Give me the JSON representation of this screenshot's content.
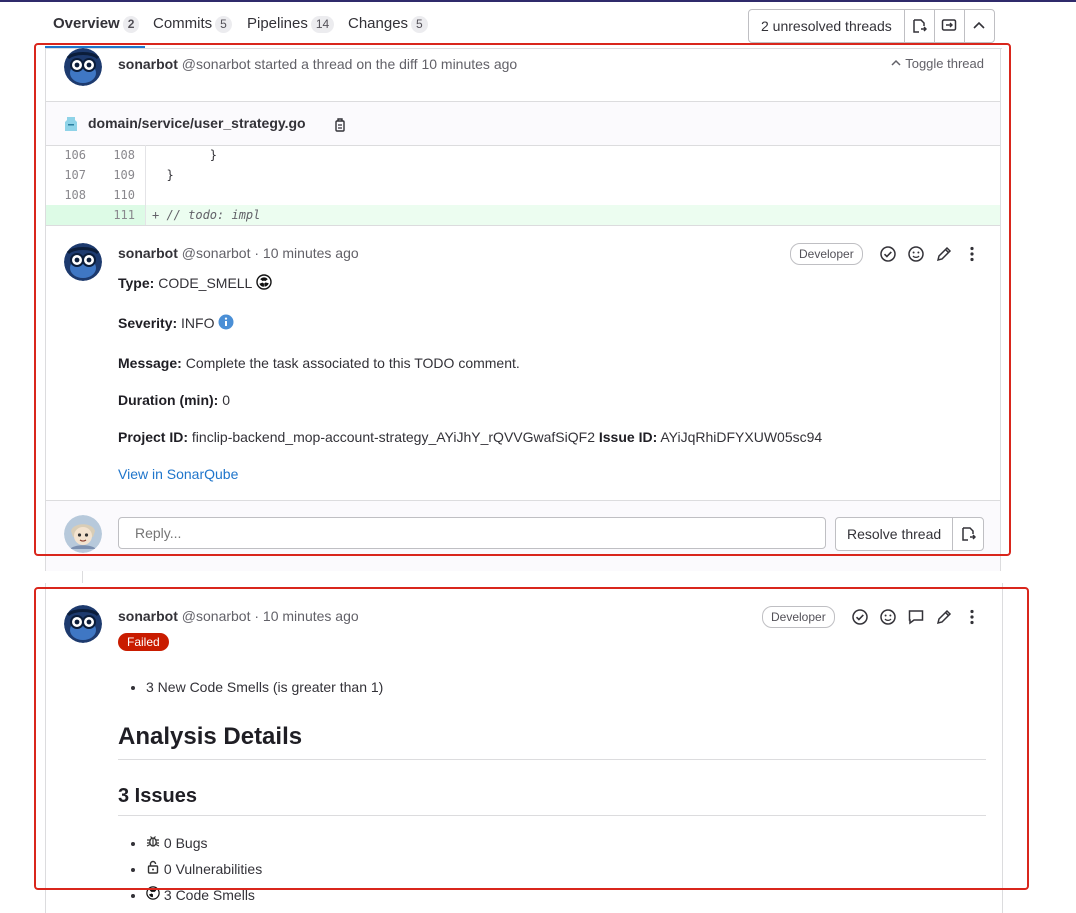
{
  "tabs": [
    {
      "label": "Overview",
      "count": "2"
    },
    {
      "label": "Commits",
      "count": "5"
    },
    {
      "label": "Pipelines",
      "count": "14"
    },
    {
      "label": "Changes",
      "count": "5"
    }
  ],
  "threads_button": {
    "label": "2 unresolved threads"
  },
  "thread1": {
    "author": "sonarbot",
    "handle": "@sonarbot",
    "action": "started a thread on the diff 10 minutes ago",
    "toggle": "Toggle thread",
    "file": "domain/service/user_strategy.go",
    "diff": [
      {
        "old": "106",
        "new": "108",
        "code": "        }",
        "type": "context"
      },
      {
        "old": "107",
        "new": "109",
        "code": "  }",
        "type": "context"
      },
      {
        "old": "108",
        "new": "110",
        "code": "",
        "type": "context"
      },
      {
        "old": "",
        "new": "111",
        "code": "+ // todo: impl",
        "type": "add"
      }
    ],
    "note": {
      "author": "sonarbot",
      "meta": "@sonarbot · 10 minutes ago",
      "role": "Developer",
      "type_label": "Type:",
      "type_value": "CODE_SMELL",
      "severity_label": "Severity:",
      "severity_value": "INFO",
      "message_label": "Message:",
      "message_value": "Complete the task associated to this TODO comment.",
      "duration_label": "Duration (min):",
      "duration_value": "0",
      "project_label": "Project ID:",
      "project_value": "finclip-backend_mop-account-strategy_AYiJhY_rQVVGwafSiQF2",
      "issue_label": "Issue ID:",
      "issue_value": "AYiJqRhiDFYXUW05sc94",
      "link": "View in SonarQube"
    },
    "reply_placeholder": "Reply...",
    "resolve_label": "Resolve thread"
  },
  "thread2": {
    "author": "sonarbot",
    "meta": "@sonarbot · 10 minutes ago",
    "role": "Developer",
    "status": "Failed",
    "conditions": [
      "3 New Code Smells (is greater than 1)"
    ],
    "heading1": "Analysis Details",
    "heading2": "3 Issues",
    "issues": [
      {
        "icon": "bug-icon",
        "text": "0 Bugs"
      },
      {
        "icon": "lock-icon",
        "text": "0 Vulnerabilities"
      },
      {
        "icon": "radiation-icon",
        "text": "3 Code Smells"
      }
    ]
  },
  "colors": {
    "annotation": "#d9261c",
    "link": "#1f75cb",
    "failed": "#c91c00",
    "added_line": "#ecfdf0"
  }
}
